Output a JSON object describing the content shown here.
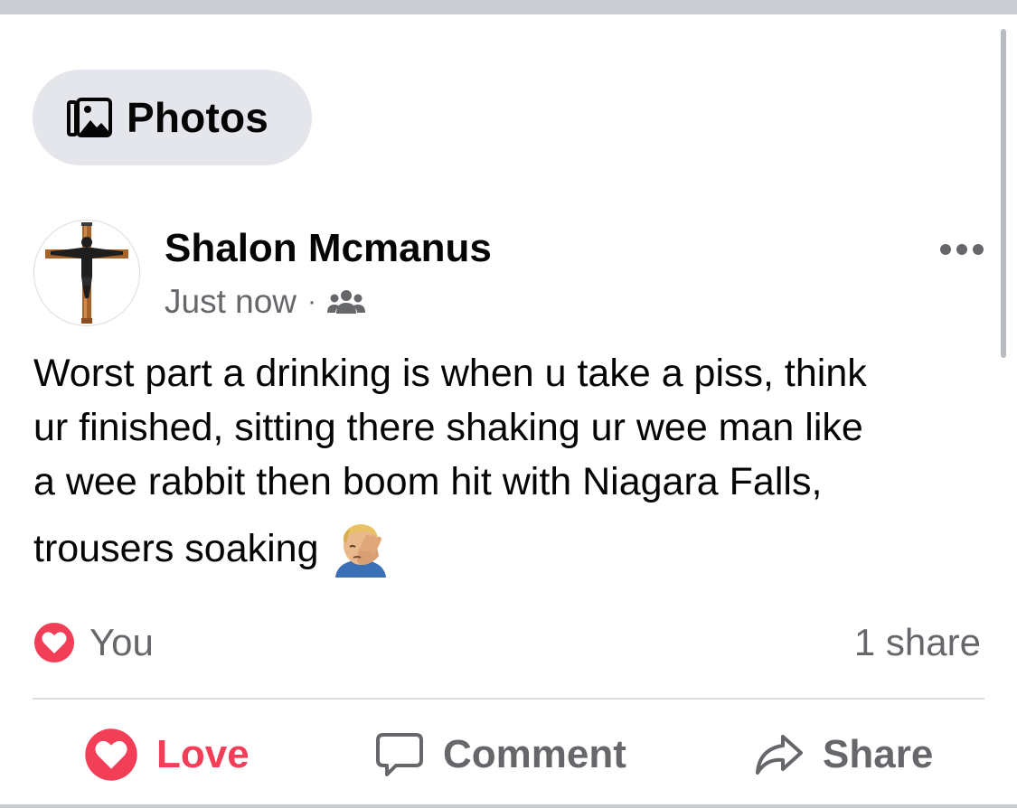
{
  "filter": {
    "photos_label": "Photos",
    "icon": "photos-icon"
  },
  "post": {
    "author": "Shalon Mcmanus",
    "timestamp": "Just now",
    "separator": "·",
    "audience_icon": "friends-audience-icon",
    "text_lines": [
      "Worst part a drinking is when u take a piss, think",
      "ur finished, sitting there shaking ur wee man like",
      "a wee rabbit then boom hit with Niagara Falls,",
      "trousers soaking"
    ],
    "emoji": "facepalm"
  },
  "reactions": {
    "summary_label": "You",
    "share_count": "1 share",
    "reaction_type": "love"
  },
  "actions": {
    "love_label": "Love",
    "comment_label": "Comment",
    "share_label": "Share"
  },
  "colors": {
    "love": "#f33e58",
    "secondary_text": "#65676b",
    "pill_bg": "#e4e6eb",
    "divider": "#dadde1"
  }
}
